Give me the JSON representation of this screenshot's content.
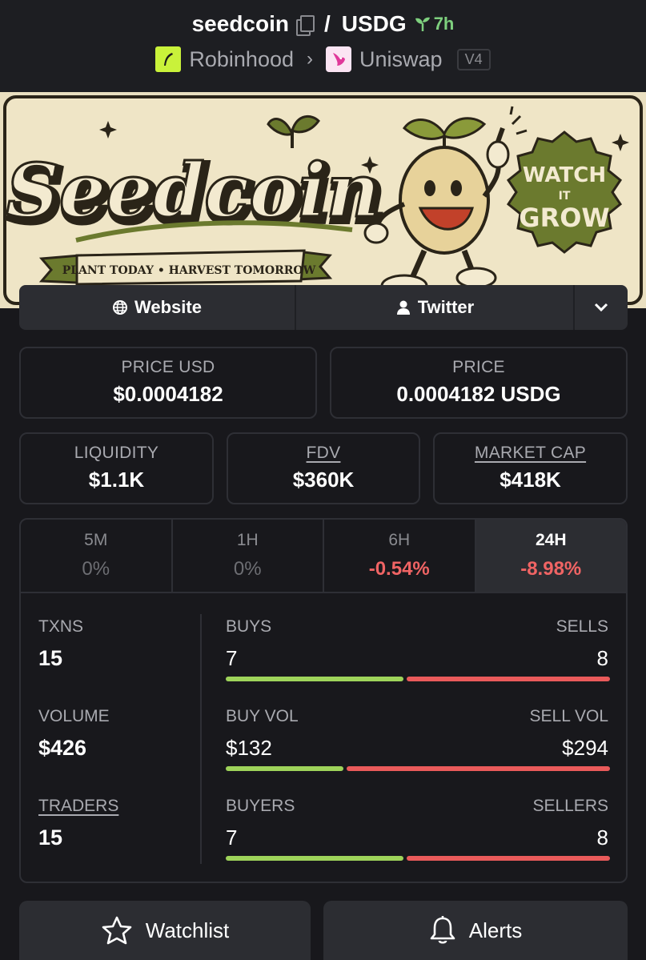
{
  "header": {
    "token": "seedcoin",
    "separator": "/",
    "quote": "USDG",
    "age": "7h",
    "chain": "Robinhood",
    "dex": "Uniswap",
    "version": "V4"
  },
  "banner": {
    "title": "Seedcoin",
    "ribbon": "PLANT TODAY • HARVEST TOMORROW",
    "badge_line1": "WATCH",
    "badge_line2": "IT",
    "badge_line3": "GROW"
  },
  "links": {
    "website": "Website",
    "twitter": "Twitter"
  },
  "stats": {
    "price_usd_label": "PRICE USD",
    "price_usd": "$0.0004182",
    "price_label": "PRICE",
    "price": "0.0004182 USDG",
    "liquidity_label": "LIQUIDITY",
    "liquidity": "$1.1K",
    "fdv_label": "FDV",
    "fdv": "$360K",
    "mcap_label": "MARKET CAP",
    "mcap": "$418K"
  },
  "periods": [
    {
      "label": "5M",
      "value": "0%"
    },
    {
      "label": "1H",
      "value": "0%"
    },
    {
      "label": "6H",
      "value": "-0.54%"
    },
    {
      "label": "24H",
      "value": "-8.98%"
    }
  ],
  "metrics": {
    "txns_label": "TXNS",
    "txns": "15",
    "volume_label": "VOLUME",
    "volume": "$426",
    "traders_label": "TRADERS",
    "traders": "15",
    "buys_label": "BUYS",
    "buys": "7",
    "sells_label": "SELLS",
    "sells": "8",
    "buy_vol_label": "BUY VOL",
    "buy_vol": "$132",
    "sell_vol_label": "SELL VOL",
    "sell_vol": "$294",
    "buyers_label": "BUYERS",
    "buyers": "7",
    "sellers_label": "SELLERS",
    "sellers": "8"
  },
  "ratios": {
    "txns_buy_fraction": 0.467,
    "volume_buy_fraction": 0.31,
    "traders_buy_fraction": 0.467
  },
  "buttons": {
    "watchlist": "Watchlist",
    "alerts": "Alerts"
  },
  "colors": {
    "accent_green": "#9ed35a",
    "accent_red": "#e95a5a",
    "age_green": "#7ed07e"
  }
}
